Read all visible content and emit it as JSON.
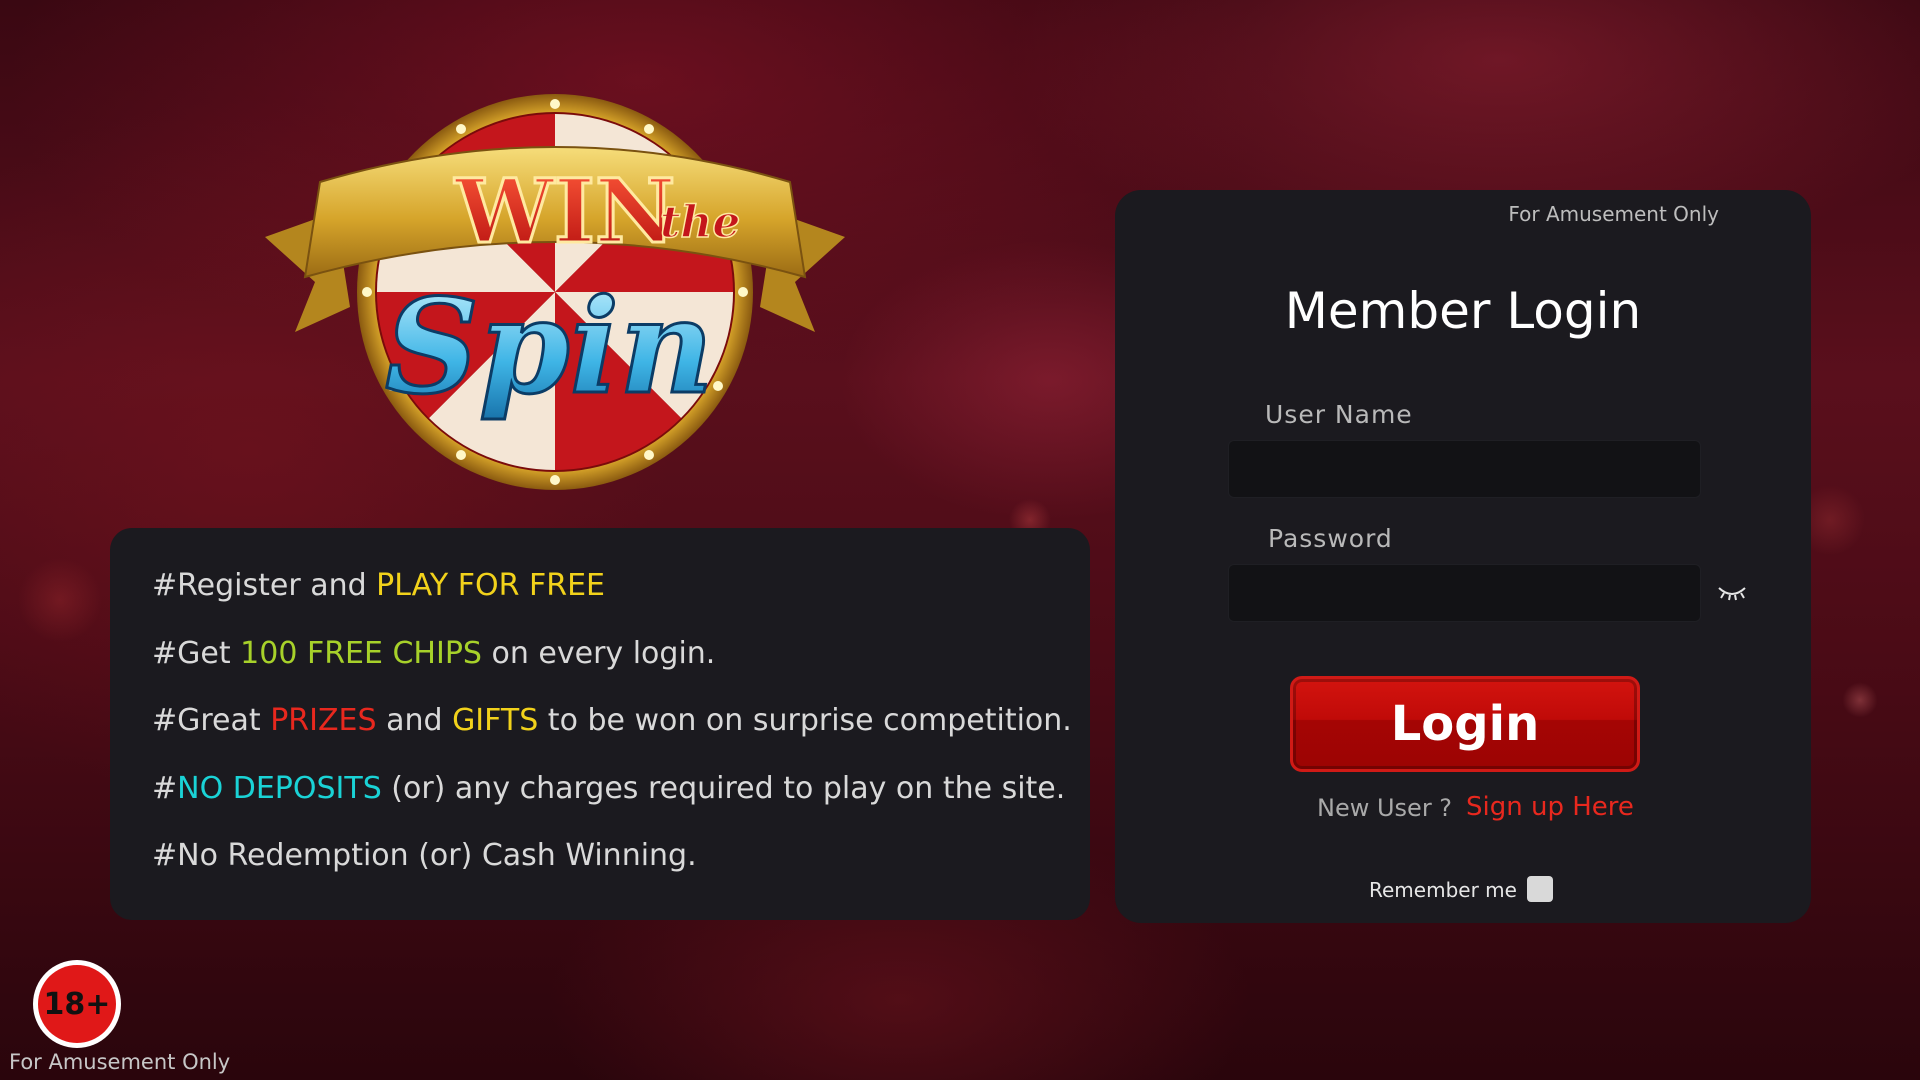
{
  "logo": {
    "word1": "WIN",
    "word2": "the",
    "word3": "Spin"
  },
  "info": {
    "lines": [
      {
        "parts": [
          "#Register and ",
          "PLAY FOR FREE",
          ""
        ]
      },
      {
        "parts": [
          "#Get ",
          "100 FREE CHIPS",
          " on every login."
        ]
      },
      {
        "parts": [
          "#Great ",
          "PRIZES",
          " and ",
          "GIFTS",
          " to be won on surprise competition."
        ]
      },
      {
        "parts": [
          "#",
          "NO DEPOSITS",
          " (or) any charges required to play on the site."
        ]
      },
      {
        "parts": [
          "#No Redemption (or) Cash Winning."
        ]
      }
    ]
  },
  "login": {
    "amusement_note": "For Amusement Only",
    "title": "Member Login",
    "username_label": "User Name",
    "username_value": "",
    "password_label": "Password",
    "password_value": "",
    "button_label": "Login",
    "new_user_text": "New User ?",
    "signup_label": "Sign up Here",
    "remember_label": "Remember me",
    "remember_checked": false
  },
  "footer": {
    "age_badge": "18+",
    "amusement_note": "For Amusement Only"
  },
  "colors": {
    "highlight_yellow": "#f2d21b",
    "highlight_green": "#a7d12a",
    "highlight_red": "#e8281e",
    "highlight_cyan": "#1ad3d6",
    "panel_bg": "#1b1a1f",
    "login_button": "#c00a08"
  }
}
